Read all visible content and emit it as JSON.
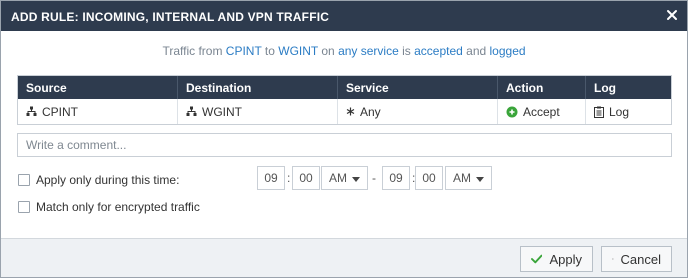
{
  "dialog": {
    "title": "ADD RULE: INCOMING, INTERNAL AND VPN TRAFFIC",
    "close_icon": "close-icon"
  },
  "summary": {
    "t1": "Traffic from ",
    "source": "CPINT",
    "t2": " to ",
    "destination": "WGINT",
    "t3": " on ",
    "service": "any service",
    "t4": " is ",
    "action": "accepted",
    "t5": " and ",
    "log": "logged"
  },
  "table": {
    "headers": [
      "Source",
      "Destination",
      "Service",
      "Action",
      "Log"
    ],
    "row": {
      "source": "CPINT",
      "destination": "WGINT",
      "service": "Any",
      "action": "Accept",
      "log": "Log"
    },
    "icons": {
      "source": "network-icon",
      "destination": "network-icon",
      "service": "asterisk-icon",
      "action": "accept-icon",
      "log": "clipboard-icon"
    }
  },
  "comment": {
    "placeholder": "Write a comment..."
  },
  "options": {
    "time_label": "Apply only during this time:",
    "encrypted_label": "Match only for encrypted traffic"
  },
  "time": {
    "start_hour": "09",
    "start_minute": "00",
    "start_ampm": "AM",
    "separator": "-",
    "end_hour": "09",
    "end_minute": "00",
    "end_ampm": "AM",
    "colon": ":"
  },
  "footer": {
    "apply": "Apply",
    "cancel": "Cancel"
  },
  "colors": {
    "header_bg": "#2e3b4e",
    "link": "#2b7cc4",
    "accept_green": "#3aa53a",
    "apply_check": "#3aa53a"
  }
}
